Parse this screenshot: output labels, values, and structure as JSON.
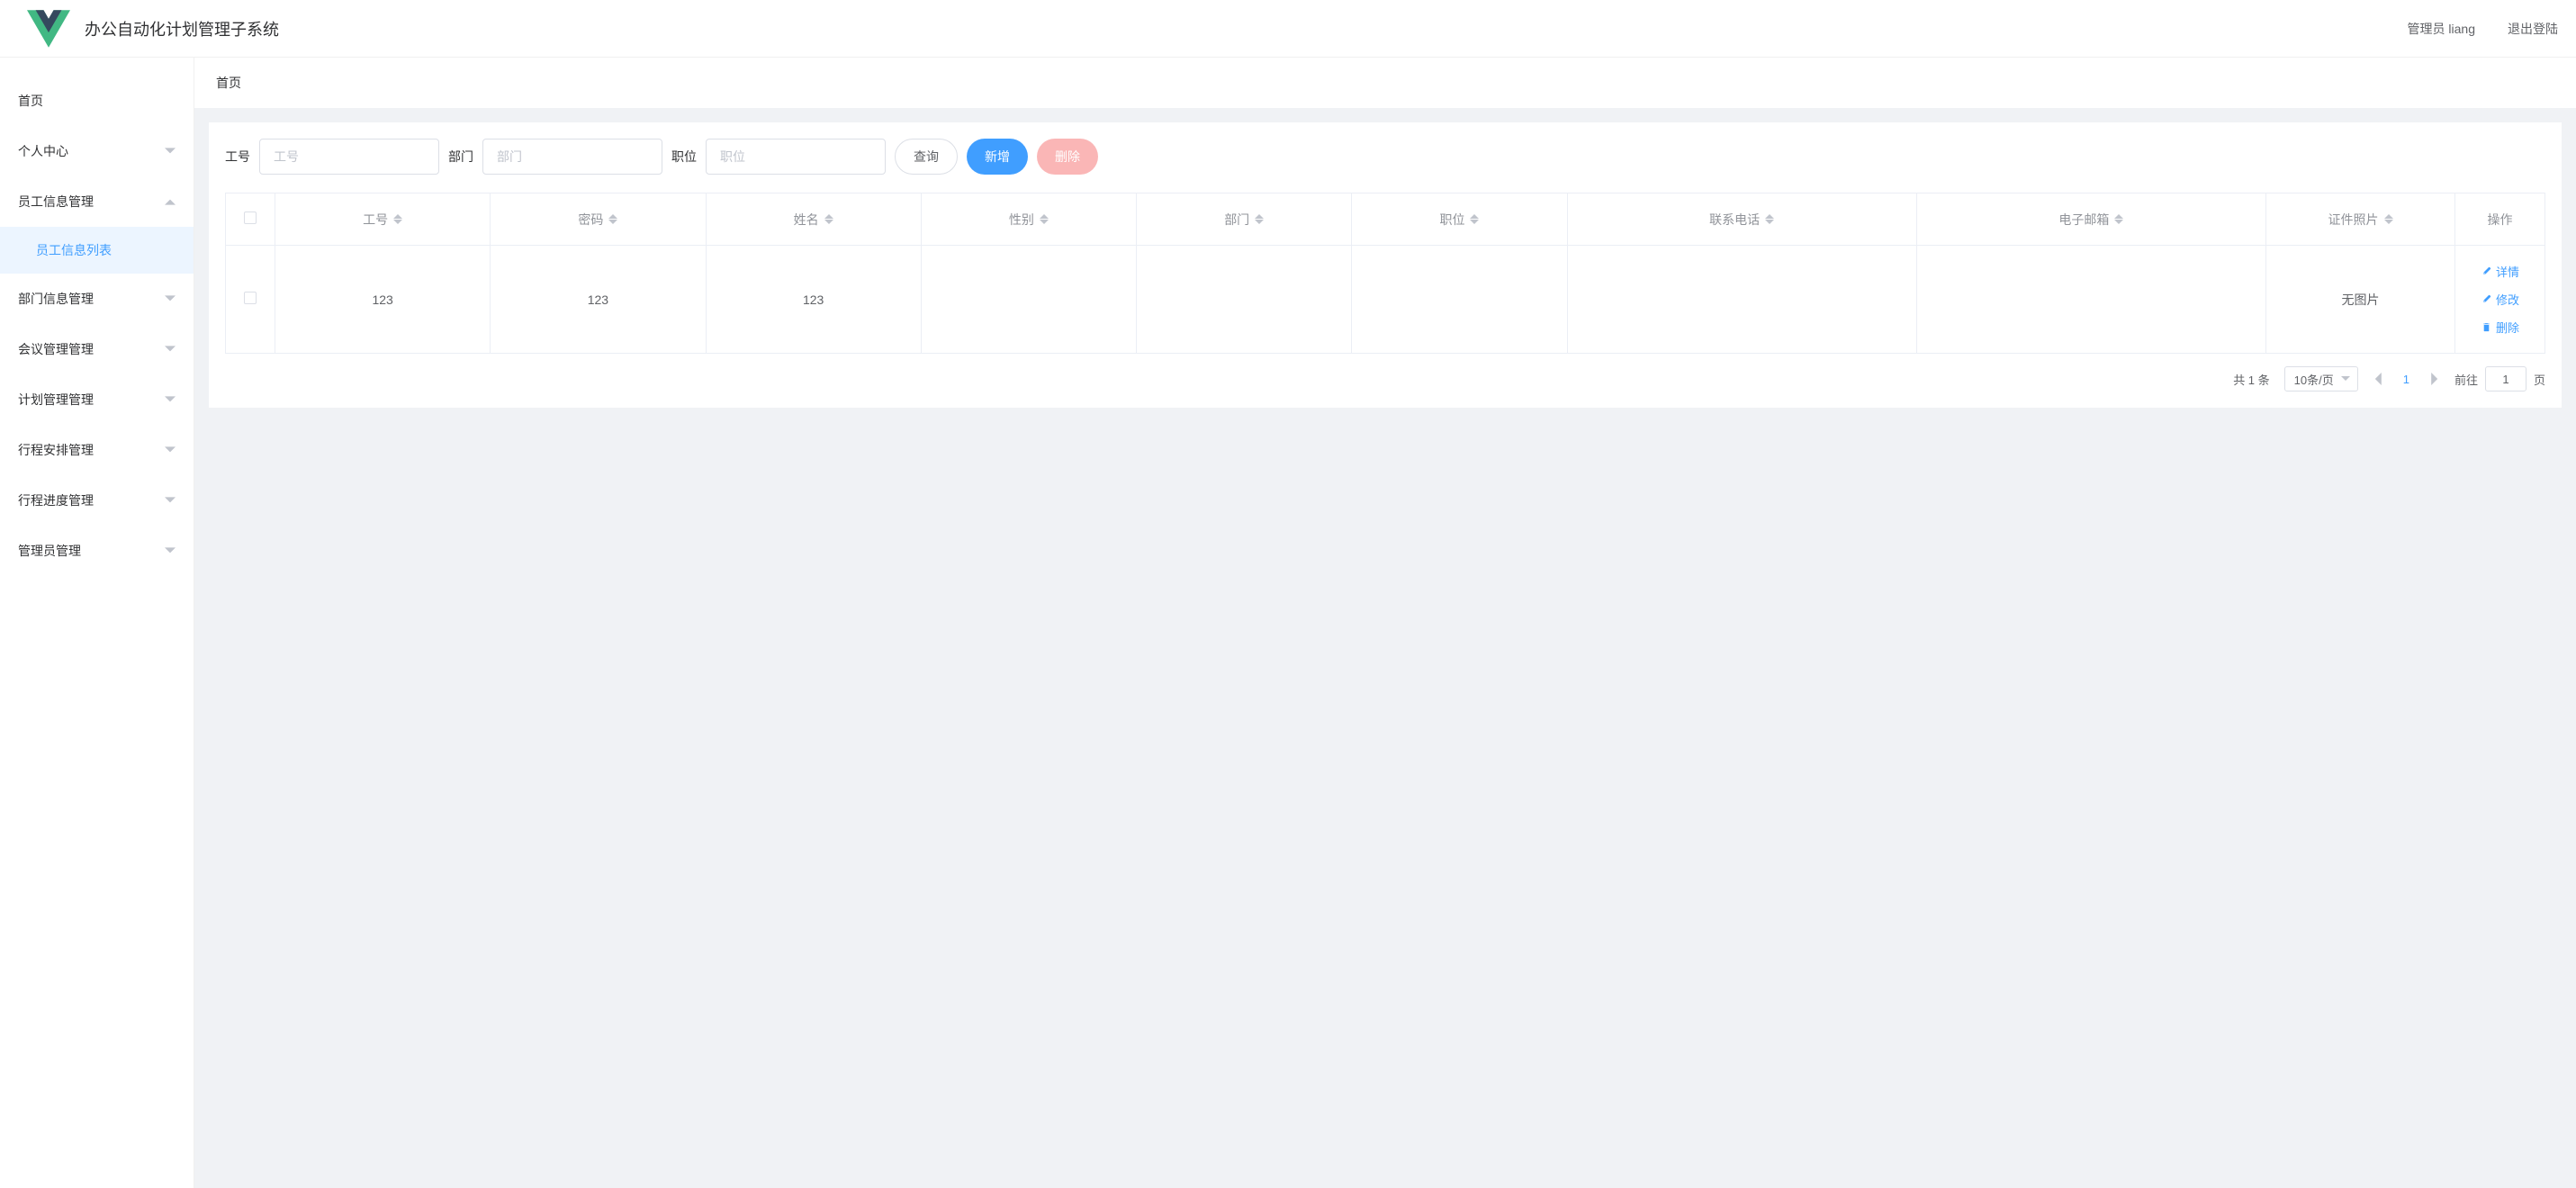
{
  "header": {
    "system_title": "办公自动化计划管理子系统",
    "admin_label": "管理员 liang",
    "logout_label": "退出登陆"
  },
  "sidebar": {
    "items": [
      {
        "label": "首页",
        "expandable": false
      },
      {
        "label": "个人中心",
        "expandable": true,
        "expanded": false
      },
      {
        "label": "员工信息管理",
        "expandable": true,
        "expanded": true,
        "children": [
          {
            "label": "员工信息列表",
            "active": true
          }
        ]
      },
      {
        "label": "部门信息管理",
        "expandable": true,
        "expanded": false
      },
      {
        "label": "会议管理管理",
        "expandable": true,
        "expanded": false
      },
      {
        "label": "计划管理管理",
        "expandable": true,
        "expanded": false
      },
      {
        "label": "行程安排管理",
        "expandable": true,
        "expanded": false
      },
      {
        "label": "行程进度管理",
        "expandable": true,
        "expanded": false
      },
      {
        "label": "管理员管理",
        "expandable": true,
        "expanded": false
      }
    ]
  },
  "breadcrumb": "首页",
  "search": {
    "gonghao_label": "工号",
    "gonghao_placeholder": "工号",
    "bumen_label": "部门",
    "bumen_placeholder": "部门",
    "zhiwei_label": "职位",
    "zhiwei_placeholder": "职位",
    "query_btn": "查询",
    "add_btn": "新增",
    "delete_btn": "删除"
  },
  "table": {
    "columns": [
      "工号",
      "密码",
      "姓名",
      "性别",
      "部门",
      "职位",
      "联系电话",
      "电子邮箱",
      "证件照片",
      "操作"
    ],
    "rows": [
      {
        "gonghao": "123",
        "mima": "123",
        "xingming": "123",
        "xingbie": "",
        "bumen": "",
        "zhiwei": "",
        "dianhua": "",
        "youxiang": "",
        "zhaopian": "无图片"
      }
    ],
    "actions": {
      "detail": "详情",
      "edit": "修改",
      "delete": "删除"
    }
  },
  "pagination": {
    "total": "共 1 条",
    "page_size": "10条/页",
    "current": "1",
    "goto_prefix": "前往",
    "goto_value": "1",
    "goto_suffix": "页"
  }
}
